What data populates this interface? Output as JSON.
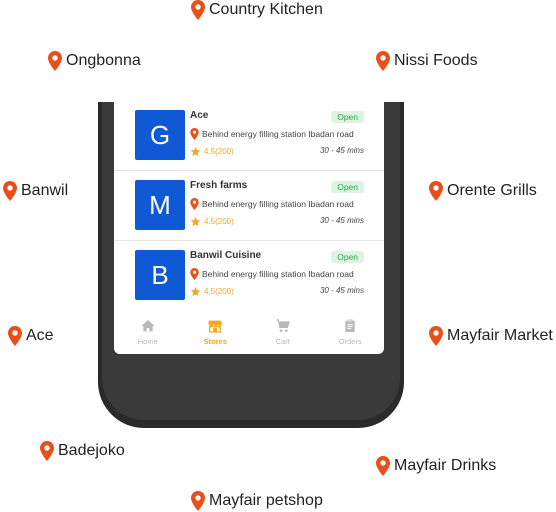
{
  "colors": {
    "pin": "#e8501a",
    "tile": "#1059d6",
    "accent": "#f5a623",
    "open": "#29a847"
  },
  "map_labels": [
    {
      "name": "Country Kitchen"
    },
    {
      "name": "Ongbonna"
    },
    {
      "name": "Nissi Foods"
    },
    {
      "name": "Banwil"
    },
    {
      "name": "Orente Grills"
    },
    {
      "name": "Ace"
    },
    {
      "name": "Mayfair Market"
    },
    {
      "name": "Badejoko"
    },
    {
      "name": "Mayfair Drinks"
    },
    {
      "name": "Mayfair petshop"
    }
  ],
  "stores": [
    {
      "initial": "G",
      "name": "Ace",
      "status": "Open",
      "address": "Behind energy filling station Ibadan road",
      "rating": "4.5(200)",
      "eta": "30  - 45 mins"
    },
    {
      "initial": "M",
      "name": "Fresh farms",
      "status": "Open",
      "address": "Behind energy filling station Ibadan road",
      "rating": "4.5(200)",
      "eta": "30  - 45 mins"
    },
    {
      "initial": "B",
      "name": "Banwil Cuisine",
      "status": "Open",
      "address": "Behind energy filling station Ibadan road",
      "rating": "4.5(200)",
      "eta": "30  - 45 mins"
    }
  ],
  "tabs": [
    {
      "label": "Home",
      "icon": "home-icon",
      "active": false
    },
    {
      "label": "Stores",
      "icon": "store-icon",
      "active": true
    },
    {
      "label": "Cart",
      "icon": "cart-icon",
      "active": false
    },
    {
      "label": "Orders",
      "icon": "orders-icon",
      "active": false
    }
  ]
}
